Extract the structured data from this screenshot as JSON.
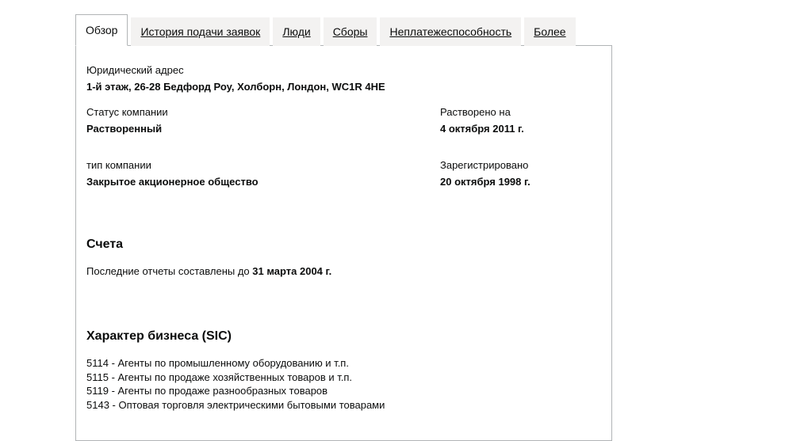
{
  "tabs": [
    {
      "label": "Обзор",
      "active": true
    },
    {
      "label": "История подачи заявок",
      "active": false
    },
    {
      "label": "Люди",
      "active": false
    },
    {
      "label": "Сборы",
      "active": false
    },
    {
      "label": "Неплатежеспособность",
      "active": false
    },
    {
      "label": "Более",
      "active": false
    }
  ],
  "overview": {
    "address_label": "Юридический адрес",
    "address_value": "1-й этаж, 26-28 Бедфорд Роу, Холборн, Лондон, WC1R 4HE",
    "status_label": "Статус компании",
    "status_value": "Растворенный",
    "dissolved_label": "Растворено на",
    "dissolved_value": "4 октября 2011 г.",
    "type_label": "тип компании",
    "type_value": "Закрытое акционерное общество",
    "incorporated_label": "Зарегистрировано",
    "incorporated_value": "20 октября 1998 г."
  },
  "accounts": {
    "heading": "Счета",
    "text_prefix": "Последние отчеты составлены до ",
    "text_date": "31 марта 2004 г."
  },
  "sic": {
    "heading": "Характер бизнеса (SIC)",
    "items": [
      "5114 - Агенты по промышленному оборудованию и т.п.",
      "5115 - Агенты по продаже хозяйственных товаров и т.п.",
      "5119 - Агенты по продаже разнообразных товаров",
      "5143 - Оптовая торговля электрическими бытовыми товарами"
    ]
  }
}
